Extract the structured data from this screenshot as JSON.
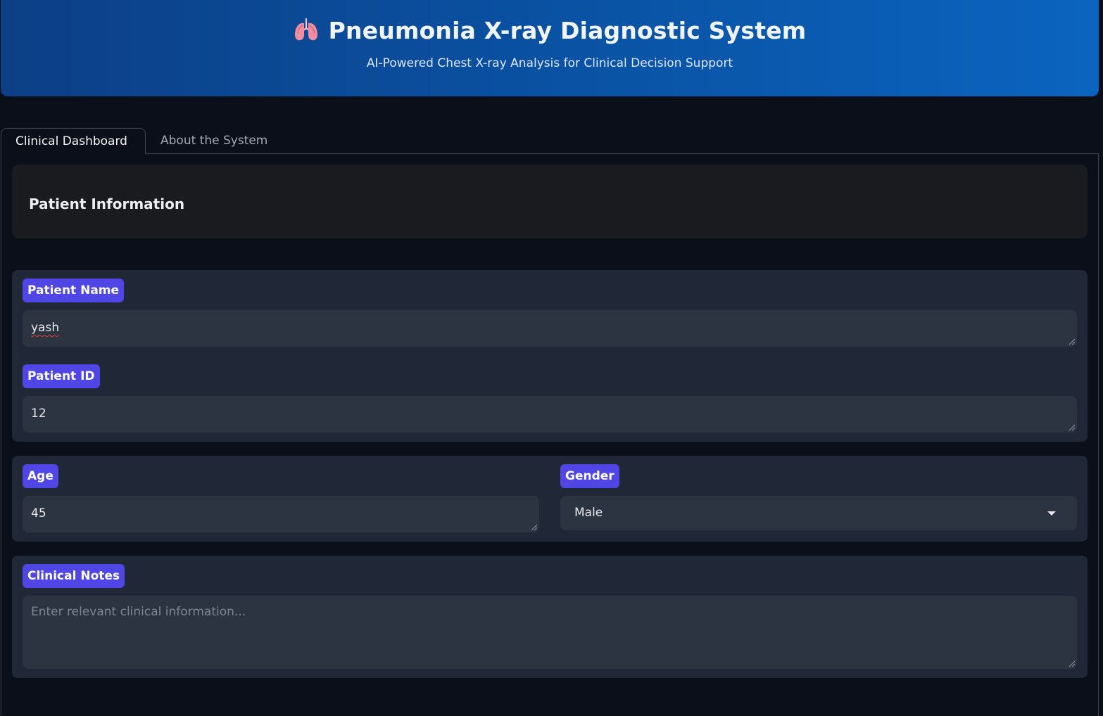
{
  "header": {
    "icon": "lungs-icon",
    "title": "Pneumonia X-ray Diagnostic System",
    "subtitle": "AI-Powered Chest X-ray Analysis for Clinical Decision Support"
  },
  "tabs": [
    {
      "label": "Clinical Dashboard",
      "active": true
    },
    {
      "label": "About the System",
      "active": false
    }
  ],
  "section": {
    "title": "Patient Information"
  },
  "form": {
    "patient_name": {
      "label": "Patient Name",
      "value": "yash"
    },
    "patient_id": {
      "label": "Patient ID",
      "value": "12"
    },
    "age": {
      "label": "Age",
      "value": "45"
    },
    "gender": {
      "label": "Gender",
      "value": "Male"
    },
    "clinical_notes": {
      "label": "Clinical Notes",
      "value": "",
      "placeholder": "Enter relevant clinical information..."
    }
  },
  "colors": {
    "background": "#0b0f19",
    "header_gradient_start": "#0c3f86",
    "header_gradient_end": "#0b64bf",
    "label_chip": "#4f46e5",
    "group_background": "#202838",
    "input_background": "#2c3442"
  }
}
